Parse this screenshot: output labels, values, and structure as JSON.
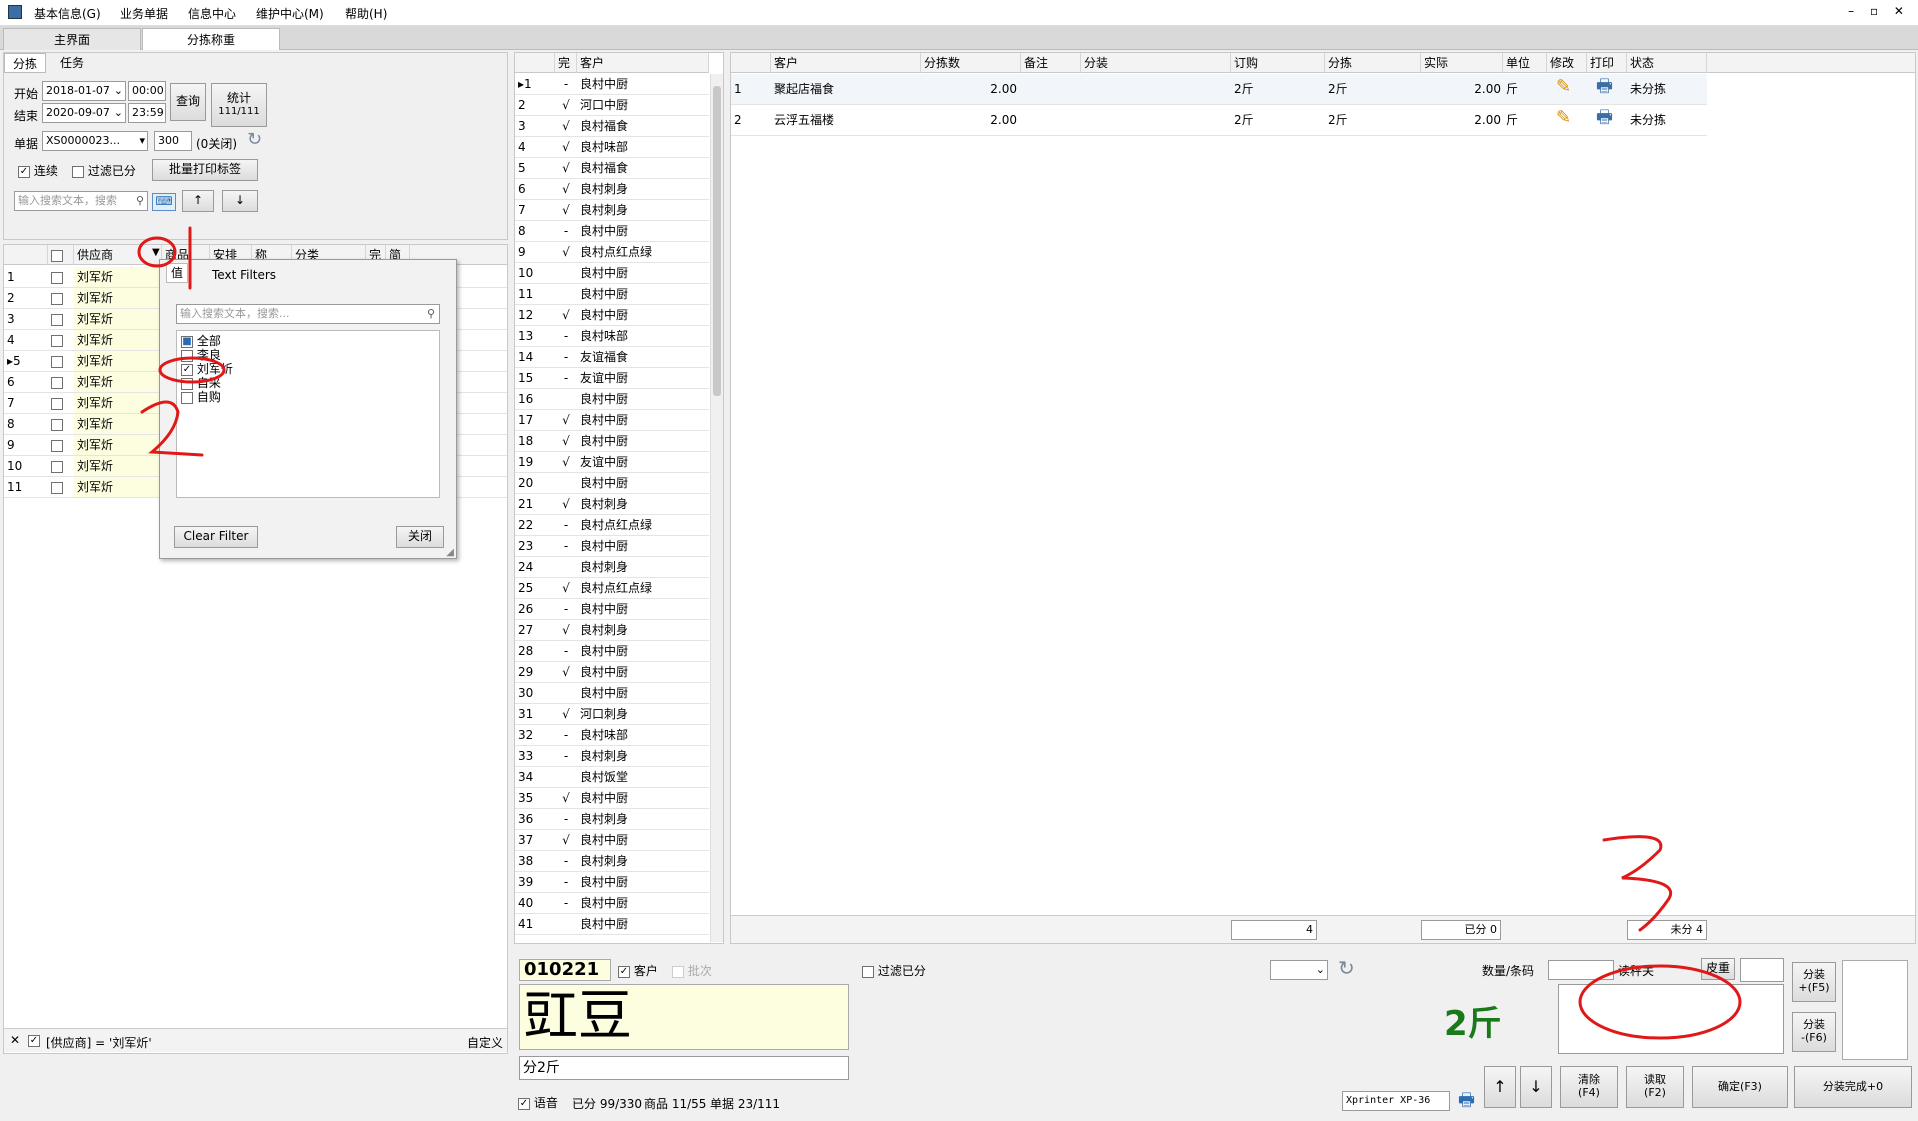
{
  "menu": {
    "items": [
      "基本信息(G)",
      "业务单据",
      "信息中心",
      "维护中心(M)",
      "帮助(H)"
    ],
    "window_controls": "– ▫ ✕"
  },
  "tabs": {
    "main": "主界面",
    "sort": "分拣称重"
  },
  "left": {
    "subtabs": [
      "分拣",
      "任务"
    ],
    "start_label": "开始",
    "start_date": "2018-01-07",
    "start_time": "00:00",
    "end_label": "结束",
    "end_date": "2020-09-07",
    "end_time": "23:59",
    "query_btn": "查询",
    "stats_btn_line1": "统计",
    "stats_btn_line2": "111/111",
    "order_label": "单据",
    "order_value": "XS0000023...",
    "count_value": "300",
    "closed_label": "(0关闭)",
    "continuous_label": "连续",
    "filter_sorted_label": "过滤已分",
    "batch_print_btn": "批量打印标签",
    "search_placeholder": "输入搜索文本，搜索",
    "up_arrow": "↑",
    "down_arrow": "↓",
    "grid_headers": [
      "供应商",
      "商品",
      "安排",
      "称",
      "分类",
      "完",
      "简"
    ],
    "rows": [
      "刘军炘",
      "刘军炘",
      "刘军炘",
      "刘军炘",
      "刘军炘",
      "刘军炘",
      "刘军炘",
      "刘军炘",
      "刘军炘",
      "刘军炘",
      "刘军炘"
    ],
    "filter_expr": "[供应商] = '刘军炘'",
    "customize": "自定义",
    "close_x": "✕"
  },
  "popup": {
    "tab_values": "值",
    "tab_text": "Text Filters",
    "search_placeholder": "输入搜索文本，搜索...",
    "items": [
      {
        "label": "全部",
        "state": "partial"
      },
      {
        "label": "李良",
        "state": "off"
      },
      {
        "label": "刘军炘",
        "state": "on"
      },
      {
        "label": "自采",
        "state": "off"
      },
      {
        "label": "自购",
        "state": "off"
      }
    ],
    "clear_btn": "Clear Filter",
    "close_btn": "关闭"
  },
  "middle": {
    "headers": [
      "完",
      "客户"
    ],
    "rows": [
      [
        "-",
        "良村中厨"
      ],
      [
        "√",
        "河口中厨"
      ],
      [
        "√",
        "良村福食"
      ],
      [
        "√",
        "良村味部"
      ],
      [
        "√",
        "良村福食"
      ],
      [
        "√",
        "良村刺身"
      ],
      [
        "√",
        "良村刺身"
      ],
      [
        "-",
        "良村中厨"
      ],
      [
        "√",
        "良村点红点绿"
      ],
      [
        "",
        "良村中厨"
      ],
      [
        "",
        "良村中厨"
      ],
      [
        "√",
        "良村中厨"
      ],
      [
        "-",
        "良村味部"
      ],
      [
        "-",
        "友谊福食"
      ],
      [
        "-",
        "友谊中厨"
      ],
      [
        "",
        "良村中厨"
      ],
      [
        "√",
        "良村中厨"
      ],
      [
        "√",
        "良村中厨"
      ],
      [
        "√",
        "友谊中厨"
      ],
      [
        "",
        "良村中厨"
      ],
      [
        "√",
        "良村刺身"
      ],
      [
        "-",
        "良村点红点绿"
      ],
      [
        "-",
        "良村中厨"
      ],
      [
        "",
        "良村刺身"
      ],
      [
        "√",
        "良村点红点绿"
      ],
      [
        "-",
        "良村中厨"
      ],
      [
        "√",
        "良村刺身"
      ],
      [
        "-",
        "良村中厨"
      ],
      [
        "√",
        "良村中厨"
      ],
      [
        "",
        "良村中厨"
      ],
      [
        "√",
        "河口刺身"
      ],
      [
        "-",
        "良村味部"
      ],
      [
        "-",
        "良村刺身"
      ],
      [
        "",
        "良村饭堂"
      ],
      [
        "√",
        "良村中厨"
      ],
      [
        "-",
        "良村刺身"
      ],
      [
        "√",
        "良村中厨"
      ],
      [
        "-",
        "良村刺身"
      ],
      [
        "-",
        "良村中厨"
      ],
      [
        "-",
        "良村中厨"
      ],
      [
        "",
        "良村中厨"
      ]
    ]
  },
  "right": {
    "headers": [
      "客户",
      "分拣数",
      "备注",
      "分装",
      "订购",
      "分拣",
      "实际",
      "单位",
      "修改",
      "打印",
      "状态"
    ],
    "rows": [
      {
        "no": "1",
        "customer": "聚起店福食",
        "qty": "2.00",
        "order": "2斤",
        "sort": "2斤",
        "actual": "2.00",
        "unit": "斤",
        "status": "未分拣"
      },
      {
        "no": "2",
        "customer": "云浮五福楼",
        "qty": "2.00",
        "order": "2斤",
        "sort": "2斤",
        "actual": "2.00",
        "unit": "斤",
        "status": "未分拣"
      }
    ],
    "footer_total": "4",
    "footer_done": "已分 0",
    "footer_undone": "未分 4"
  },
  "bottom": {
    "code": "010221",
    "customer_label": "客户",
    "batch_label": "批次",
    "product": "豇豆",
    "sub_text": "分2斤",
    "filter_label": "过滤已分",
    "weight": "2斤",
    "qty_label": "数量/条码",
    "read_label": "读秤关",
    "tare_label": "皮重",
    "pack_plus": "分装\n+(F5)",
    "pack_minus": "分装\n-(F6)",
    "clear_btn": "清除\n(F4)",
    "read_btn": "读取\n(F2)",
    "confirm_btn": "确定(F3)",
    "finish_btn": "分装完成+0",
    "voice_label": "语音",
    "status_sorted": "已分 99/330",
    "status_goods": "商品 11/55",
    "status_orders": "单据 23/111",
    "printer": "Xprinter XP-36",
    "up": "↑",
    "down": "↓"
  },
  "colors": {
    "accent": "#1f6fc4",
    "weight_green": "#1a7a1a",
    "annotation_red": "#e01818"
  }
}
